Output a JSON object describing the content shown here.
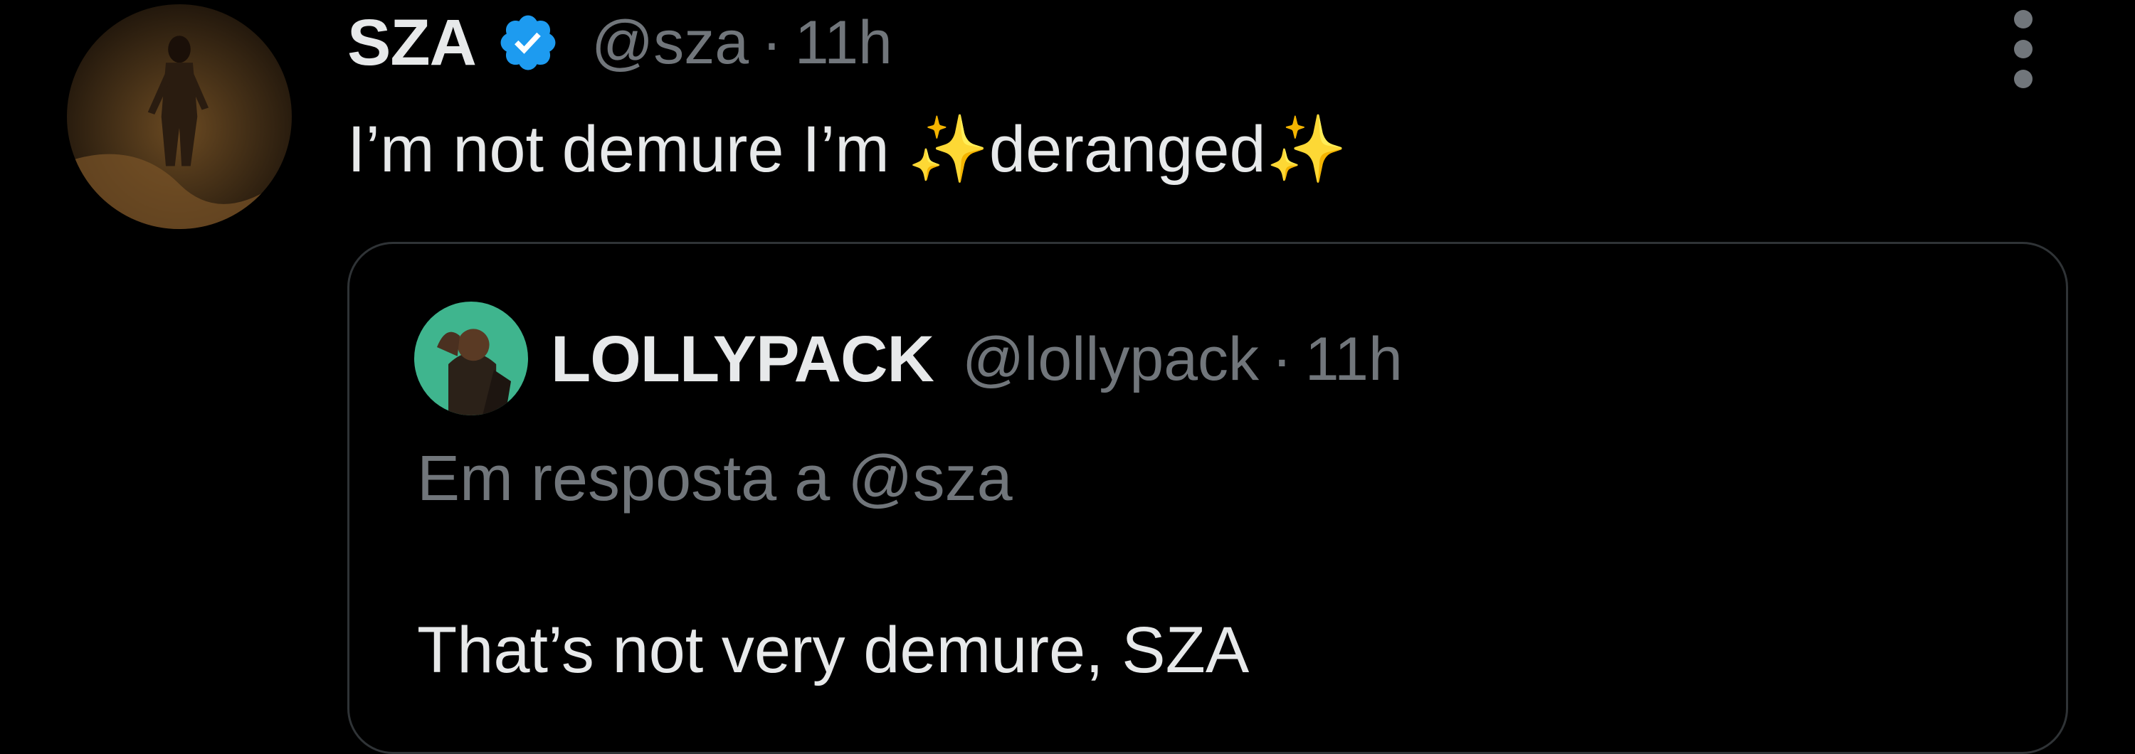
{
  "tweet": {
    "author_name": "SZA",
    "verified": true,
    "handle": "@sza",
    "separator": "·",
    "time": "11h",
    "text_before": "I’m not demure I’m ",
    "sparkle_left": "✨",
    "text_highlight": "deranged",
    "sparkle_right": "✨"
  },
  "quoted": {
    "author_name": "LOLLYPACK",
    "handle": "@lollypack",
    "separator": "·",
    "time": "11h",
    "reply_prefix": "Em resposta a",
    "reply_mention": "@sza",
    "text": "That’s not very demure, SZA"
  },
  "icons": {
    "verified": "verified-badge-icon",
    "more": "more-vertical-icon"
  },
  "colors": {
    "background": "#000000",
    "primary_text": "#e7e9ea",
    "secondary_text": "#71767b",
    "verified_blue": "#1d9bf0",
    "border": "#2f3336"
  }
}
